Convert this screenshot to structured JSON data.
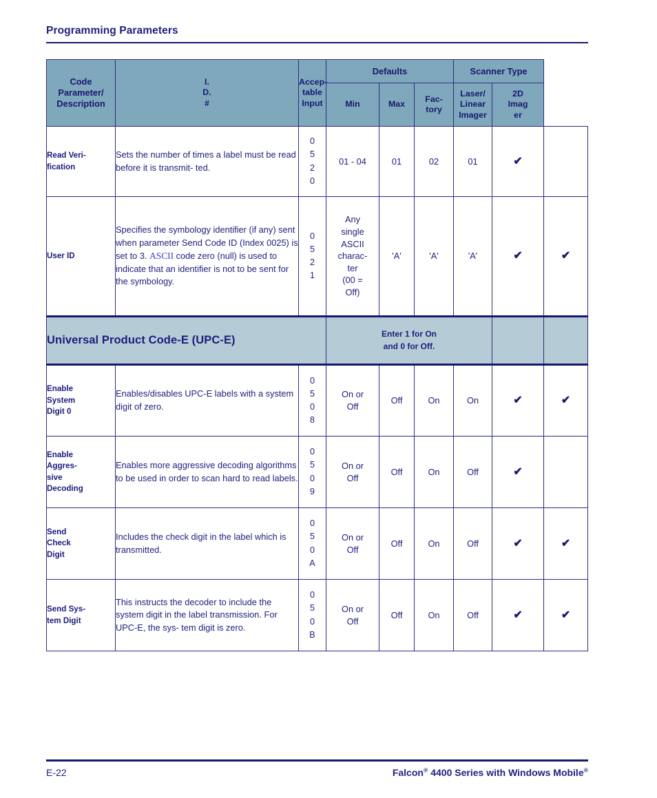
{
  "header": {
    "title": "Programming Parameters"
  },
  "table": {
    "columns": {
      "parameter": "Code Parameter/ Description",
      "id": "I. D. #",
      "id_lines": [
        "I.",
        "D.",
        "#"
      ],
      "acceptable_input": "Accep- table Input",
      "acceptable_input_lines": [
        "Accep-",
        "table",
        "Input"
      ],
      "defaults_group": "Defaults",
      "scanner_type_group": "Scanner Type",
      "min": "Min",
      "max": "Max",
      "factory": "Fac- tory",
      "factory_lines": [
        "Fac-",
        "tory"
      ],
      "laser_linear_imager": "Laser/ Linear Imager",
      "laser_linear_imager_lines": [
        "Laser/",
        "Linear",
        "Imager"
      ],
      "imager_2d": "2D Imag er",
      "imager_2d_lines": [
        "2D",
        "Imag",
        "er"
      ]
    },
    "rows": [
      {
        "name": "Read Veri- fication",
        "name_lines": [
          "Read Veri-",
          "fication"
        ],
        "description": "Sets the number of times a label must be read before it is transmit- ted.",
        "id": "0 5 2 0",
        "id_lines": [
          "0",
          "5",
          "2",
          "0"
        ],
        "input": "01 - 04",
        "min": "01",
        "max": "02",
        "factory": "01",
        "laser": "check",
        "imager2d": ""
      },
      {
        "name": "User ID",
        "name_lines": [
          "User ID"
        ],
        "description_part1": "Specifies the symbology identifier (if any) sent when parameter Send Code ID (Index 0025) is set to 3. ",
        "description_ascii": "ASCII",
        "description_part2": " code zero (null) is used to indicate that an identifier is not to be sent for the symbology.",
        "id": "0 5 2 1",
        "id_lines": [
          "0",
          "5",
          "2",
          "1"
        ],
        "input": "Any single ASCII charac- ter (00 = Off)",
        "input_lines": [
          "Any",
          "single",
          "ASCII",
          "charac-",
          "ter",
          "(00 =",
          "Off)"
        ],
        "min": "'A'",
        "max": "'A'",
        "factory": "'A'",
        "laser": "check",
        "imager2d": "check"
      }
    ],
    "section": {
      "title": "Universal Product Code-E (UPC-E)",
      "note": "Enter 1 for On and 0 for Off.",
      "note_lines": [
        "Enter 1 for On",
        "and 0 for Off."
      ]
    },
    "section_rows": [
      {
        "name": "Enable System Digit 0",
        "name_lines": [
          "Enable",
          "System",
          "Digit 0"
        ],
        "description": "Enables/disables UPC-E labels with a system digit of zero.",
        "id": "0 5 0 8",
        "id_lines": [
          "0",
          "5",
          "0",
          "8"
        ],
        "input": "On or Off",
        "input_lines": [
          "On or",
          "Off"
        ],
        "min": "Off",
        "max": "On",
        "factory": "On",
        "laser": "check",
        "imager2d": "check"
      },
      {
        "name": "Enable Aggres- sive Decoding",
        "name_lines": [
          "Enable",
          "Aggres-",
          "sive",
          "Decoding"
        ],
        "description": "Enables more aggressive decoding algorithms to be used in order to scan hard to read labels.",
        "id": "0 5 0 9",
        "id_lines": [
          "0",
          "5",
          "0",
          "9"
        ],
        "input": "On or Off",
        "input_lines": [
          "On or",
          "Off"
        ],
        "min": "Off",
        "max": "On",
        "factory": "Off",
        "laser": "check",
        "imager2d": ""
      },
      {
        "name": "Send Check Digit",
        "name_lines": [
          "Send",
          "Check",
          "Digit"
        ],
        "description": "Includes the check digit in the label which is transmitted.",
        "id": "0 5 0 A",
        "id_lines": [
          "0",
          "5",
          "0",
          "A"
        ],
        "input": "On or Off",
        "input_lines": [
          "On or",
          "Off"
        ],
        "min": "Off",
        "max": "On",
        "factory": "Off",
        "laser": "check",
        "imager2d": "check"
      },
      {
        "name": "Send Sys- tem Digit",
        "name_lines": [
          "Send Sys-",
          "tem Digit"
        ],
        "description": "This instructs the decoder to include the system digit in the label transmission. For UPC-E, the sys- tem digit is zero.",
        "id": "0 5 0 B",
        "id_lines": [
          "0",
          "5",
          "0",
          "B"
        ],
        "input": "On or Off",
        "input_lines": [
          "On or",
          "Off"
        ],
        "min": "Off",
        "max": "On",
        "factory": "Off",
        "laser": "check",
        "imager2d": "check"
      }
    ],
    "check_glyph": "✔"
  },
  "footer": {
    "page_number": "E-22",
    "doc_title_part1": "Falcon",
    "doc_title_part2": " 4400 Series with Windows Mobile",
    "registered_mark": "®"
  },
  "colors": {
    "header_bg": "#80a8bc",
    "section_bg": "#b5ccd7",
    "text_navy": "#1a1a7d",
    "border": "#2b2b80",
    "ascii_blue": "#3a3ad0"
  }
}
